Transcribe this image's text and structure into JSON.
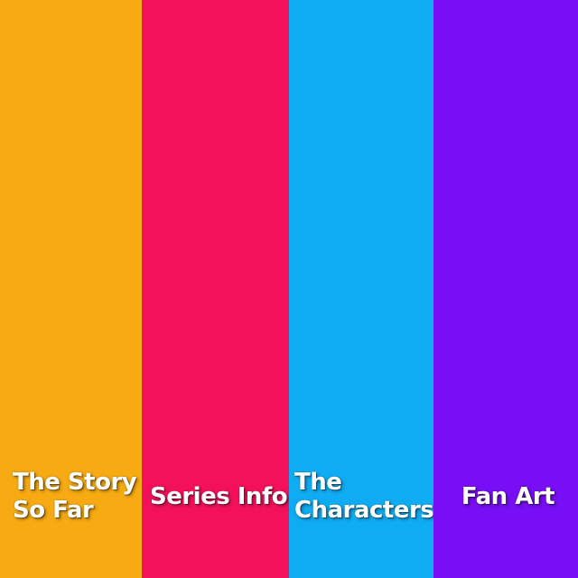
{
  "panels": [
    {
      "lines": [
        "The Story",
        "So Far"
      ],
      "color": "#F7AA12"
    },
    {
      "lines": [
        "Series Info"
      ],
      "color": "#F3125A"
    },
    {
      "lines": [
        "The",
        "Characters"
      ],
      "color": "#10ACF3"
    },
    {
      "lines": [
        "Fan Art"
      ],
      "color": "#780EF5"
    }
  ]
}
